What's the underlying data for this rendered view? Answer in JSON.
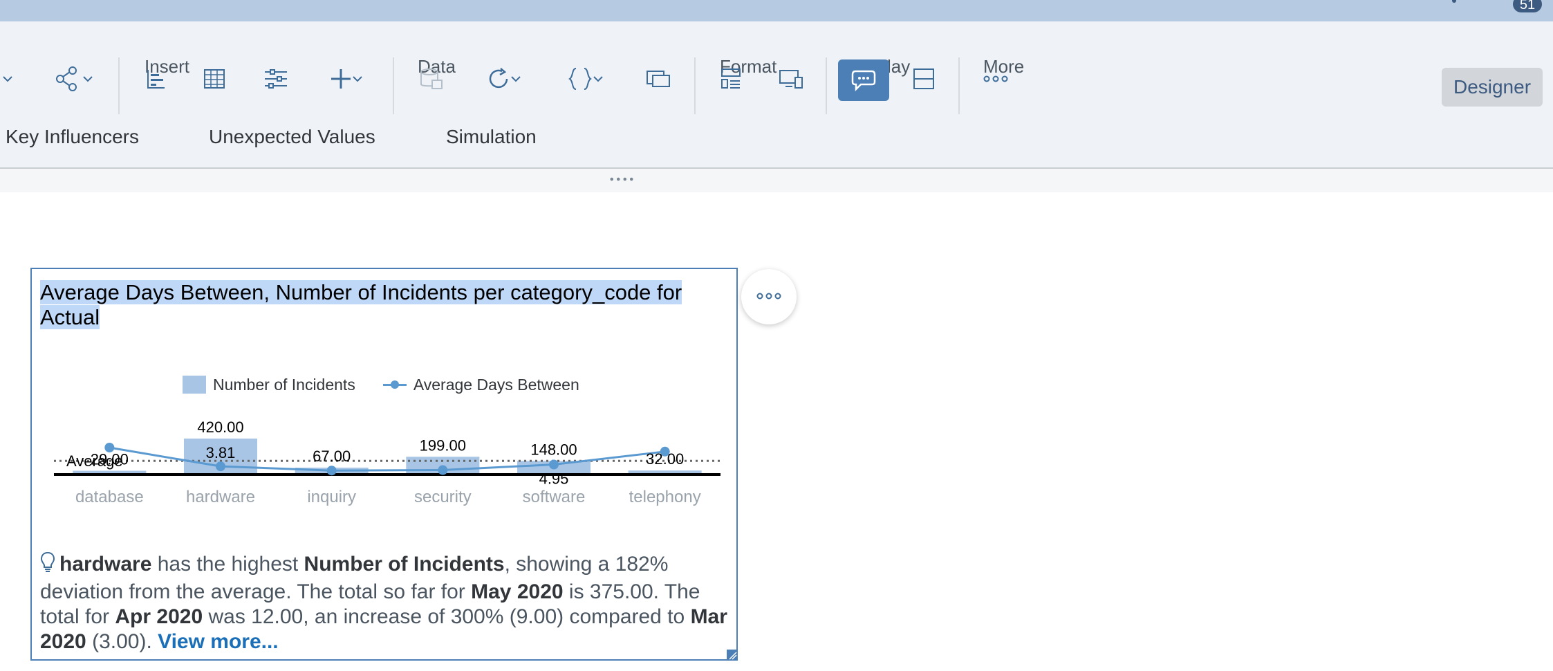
{
  "notifications": {
    "count": "51"
  },
  "toolbar": {
    "groups": {
      "insert": "Insert",
      "data": "Data",
      "format": "Format",
      "display": "Display",
      "more": "More"
    },
    "designer_label": "Designer",
    "icons": [
      "chevron-down-icon",
      "share-icon",
      "chevron-down-icon",
      "bar-chart-icon",
      "table-icon",
      "input-control-icon",
      "add-icon",
      "chevron-down-icon",
      "data-source-icon",
      "refresh-icon",
      "chevron-down-icon",
      "formula-icon",
      "chevron-down-icon",
      "linked-analysis-icon",
      "styling-icon",
      "responsive-icon",
      "comment-icon",
      "layout-icon",
      "more-icon"
    ]
  },
  "smart_tabs": [
    "Key Influencers",
    "Unexpected Values",
    "Simulation"
  ],
  "card": {
    "title": "Average Days Between, Number of Incidents per category_code for Actual",
    "legend": {
      "bar": "Number of Incidents",
      "line": "Average Days Between"
    },
    "average_label": "Average",
    "insight": {
      "subject": "hardware",
      "t1": " has the highest ",
      "measure": "Number of Incidents",
      "t2": ", showing a 182% deviation from the average. The total so far for ",
      "period1": "May 2020",
      "t3": " is 375.00. The total for ",
      "period2": "Apr 2020",
      "t4": " was 12.00, an increase of 300% (9.00) compared to ",
      "period3": "Mar 2020",
      "t5": " (3.00). ",
      "link": "View more..."
    }
  },
  "chart_data": {
    "type": "bar",
    "title": "Average Days Between, Number of Incidents per category_code for Actual",
    "categories": [
      "database",
      "hardware",
      "inquiry",
      "security",
      "software",
      "telephony"
    ],
    "series": [
      {
        "name": "Number of Incidents",
        "type": "bar",
        "values": [
          29.0,
          420.0,
          67.0,
          199.0,
          148.0,
          32.0
        ],
        "labels": [
          "29.00",
          "420.00",
          "67.00",
          "199.00",
          "148.00",
          "32.00"
        ]
      },
      {
        "name": "Average Days Between",
        "type": "line",
        "values": [
          15.5,
          3.81,
          1.2,
          1.5,
          4.95,
          13.0
        ],
        "labels": [
          "",
          "3.81",
          "",
          "",
          "4.95",
          ""
        ]
      }
    ],
    "reference_line": {
      "label": "Average",
      "style": "dotted"
    },
    "legend_position": "top",
    "colors": {
      "bar": "#a8c5e6",
      "line": "#5b9ad1",
      "average": "#666666"
    }
  }
}
